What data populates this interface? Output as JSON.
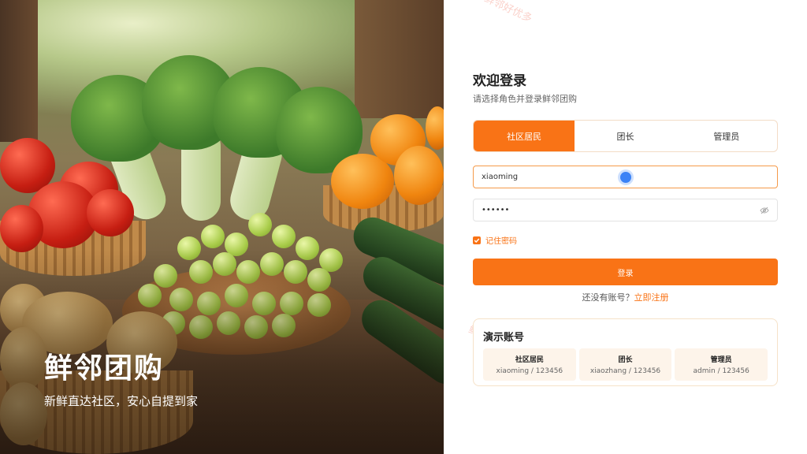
{
  "hero": {
    "title": "鲜邻团购",
    "subtitle": "新鲜直达社区，安心自提到家"
  },
  "watermark": "鲜邻好优多",
  "login": {
    "title": "欢迎登录",
    "subtitle": "请选择角色并登录鲜邻团购",
    "roles": [
      "社区居民",
      "团长",
      "管理员"
    ],
    "active_role_index": 0,
    "username_value": "xiaoming",
    "password_value": "••••••",
    "remember_label": "记住密码",
    "remember_checked": true,
    "submit_label": "登录",
    "register_prompt": "还没有账号？",
    "register_link": "立即注册"
  },
  "demo": {
    "title": "演示账号",
    "accounts": [
      {
        "role": "社区居民",
        "credential": "xiaoming / 123456"
      },
      {
        "role": "团长",
        "credential": "xiaozhang / 123456"
      },
      {
        "role": "管理员",
        "credential": "admin / 123456"
      }
    ]
  },
  "colors": {
    "accent": "#f97316",
    "demo_card_bg": "#fdf4ea",
    "border": "#f3dcc6"
  }
}
